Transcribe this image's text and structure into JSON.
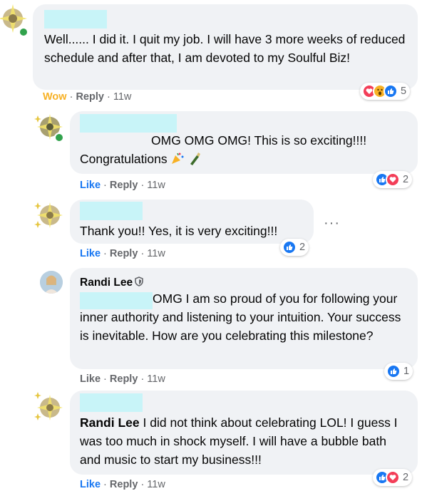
{
  "comments": [
    {
      "text": "Well...... I did it. I quit my job. I will have 3 more weeks of reduced schedule and after that, I am devoted to my Soulful Biz!",
      "actions": {
        "reaction_label": "Wow",
        "reply": "Reply",
        "time": "11w"
      },
      "reactions": {
        "icons": [
          "love",
          "wow",
          "like"
        ],
        "count": "5"
      }
    },
    {
      "text": "OMG OMG OMG! This is so exciting!!!!",
      "text2": "Congratulations",
      "actions": {
        "reaction_label": "Like",
        "reply": "Reply",
        "time": "11w"
      },
      "reactions": {
        "icons": [
          "like",
          "love"
        ],
        "count": "2"
      }
    },
    {
      "text": "Thank you!! Yes, it is very exciting!!!",
      "actions": {
        "reaction_label": "Like",
        "reply": "Reply",
        "time": "11w"
      },
      "reactions": {
        "icons": [
          "like"
        ],
        "count": "2"
      }
    },
    {
      "author": "Randi Lee",
      "text": "OMG I am so proud of you for following your inner authority and listening to your intuition. Your success is inevitable. How are you celebrating this milestone?",
      "actions": {
        "reaction_label": "Like",
        "reply": "Reply",
        "time": "11w"
      },
      "reactions": {
        "icons": [
          "like"
        ],
        "count": "1"
      }
    },
    {
      "mention": "Randi Lee",
      "text": "I did not think about celebrating LOL! I guess I was too much in shock myself. I will have a bubble bath and music to start my business!!!",
      "actions": {
        "reaction_label": "Like",
        "reply": "Reply",
        "time": "11w"
      },
      "reactions": {
        "icons": [
          "like",
          "love"
        ],
        "count": "2"
      }
    }
  ],
  "separator": "·",
  "more_options": "···",
  "colors": {
    "like": "#1877f2",
    "love": "#f33e58",
    "wow": "#f7b125",
    "bubble": "#f0f2f5",
    "redacted": "#c8f4f8",
    "online": "#31a24c"
  }
}
